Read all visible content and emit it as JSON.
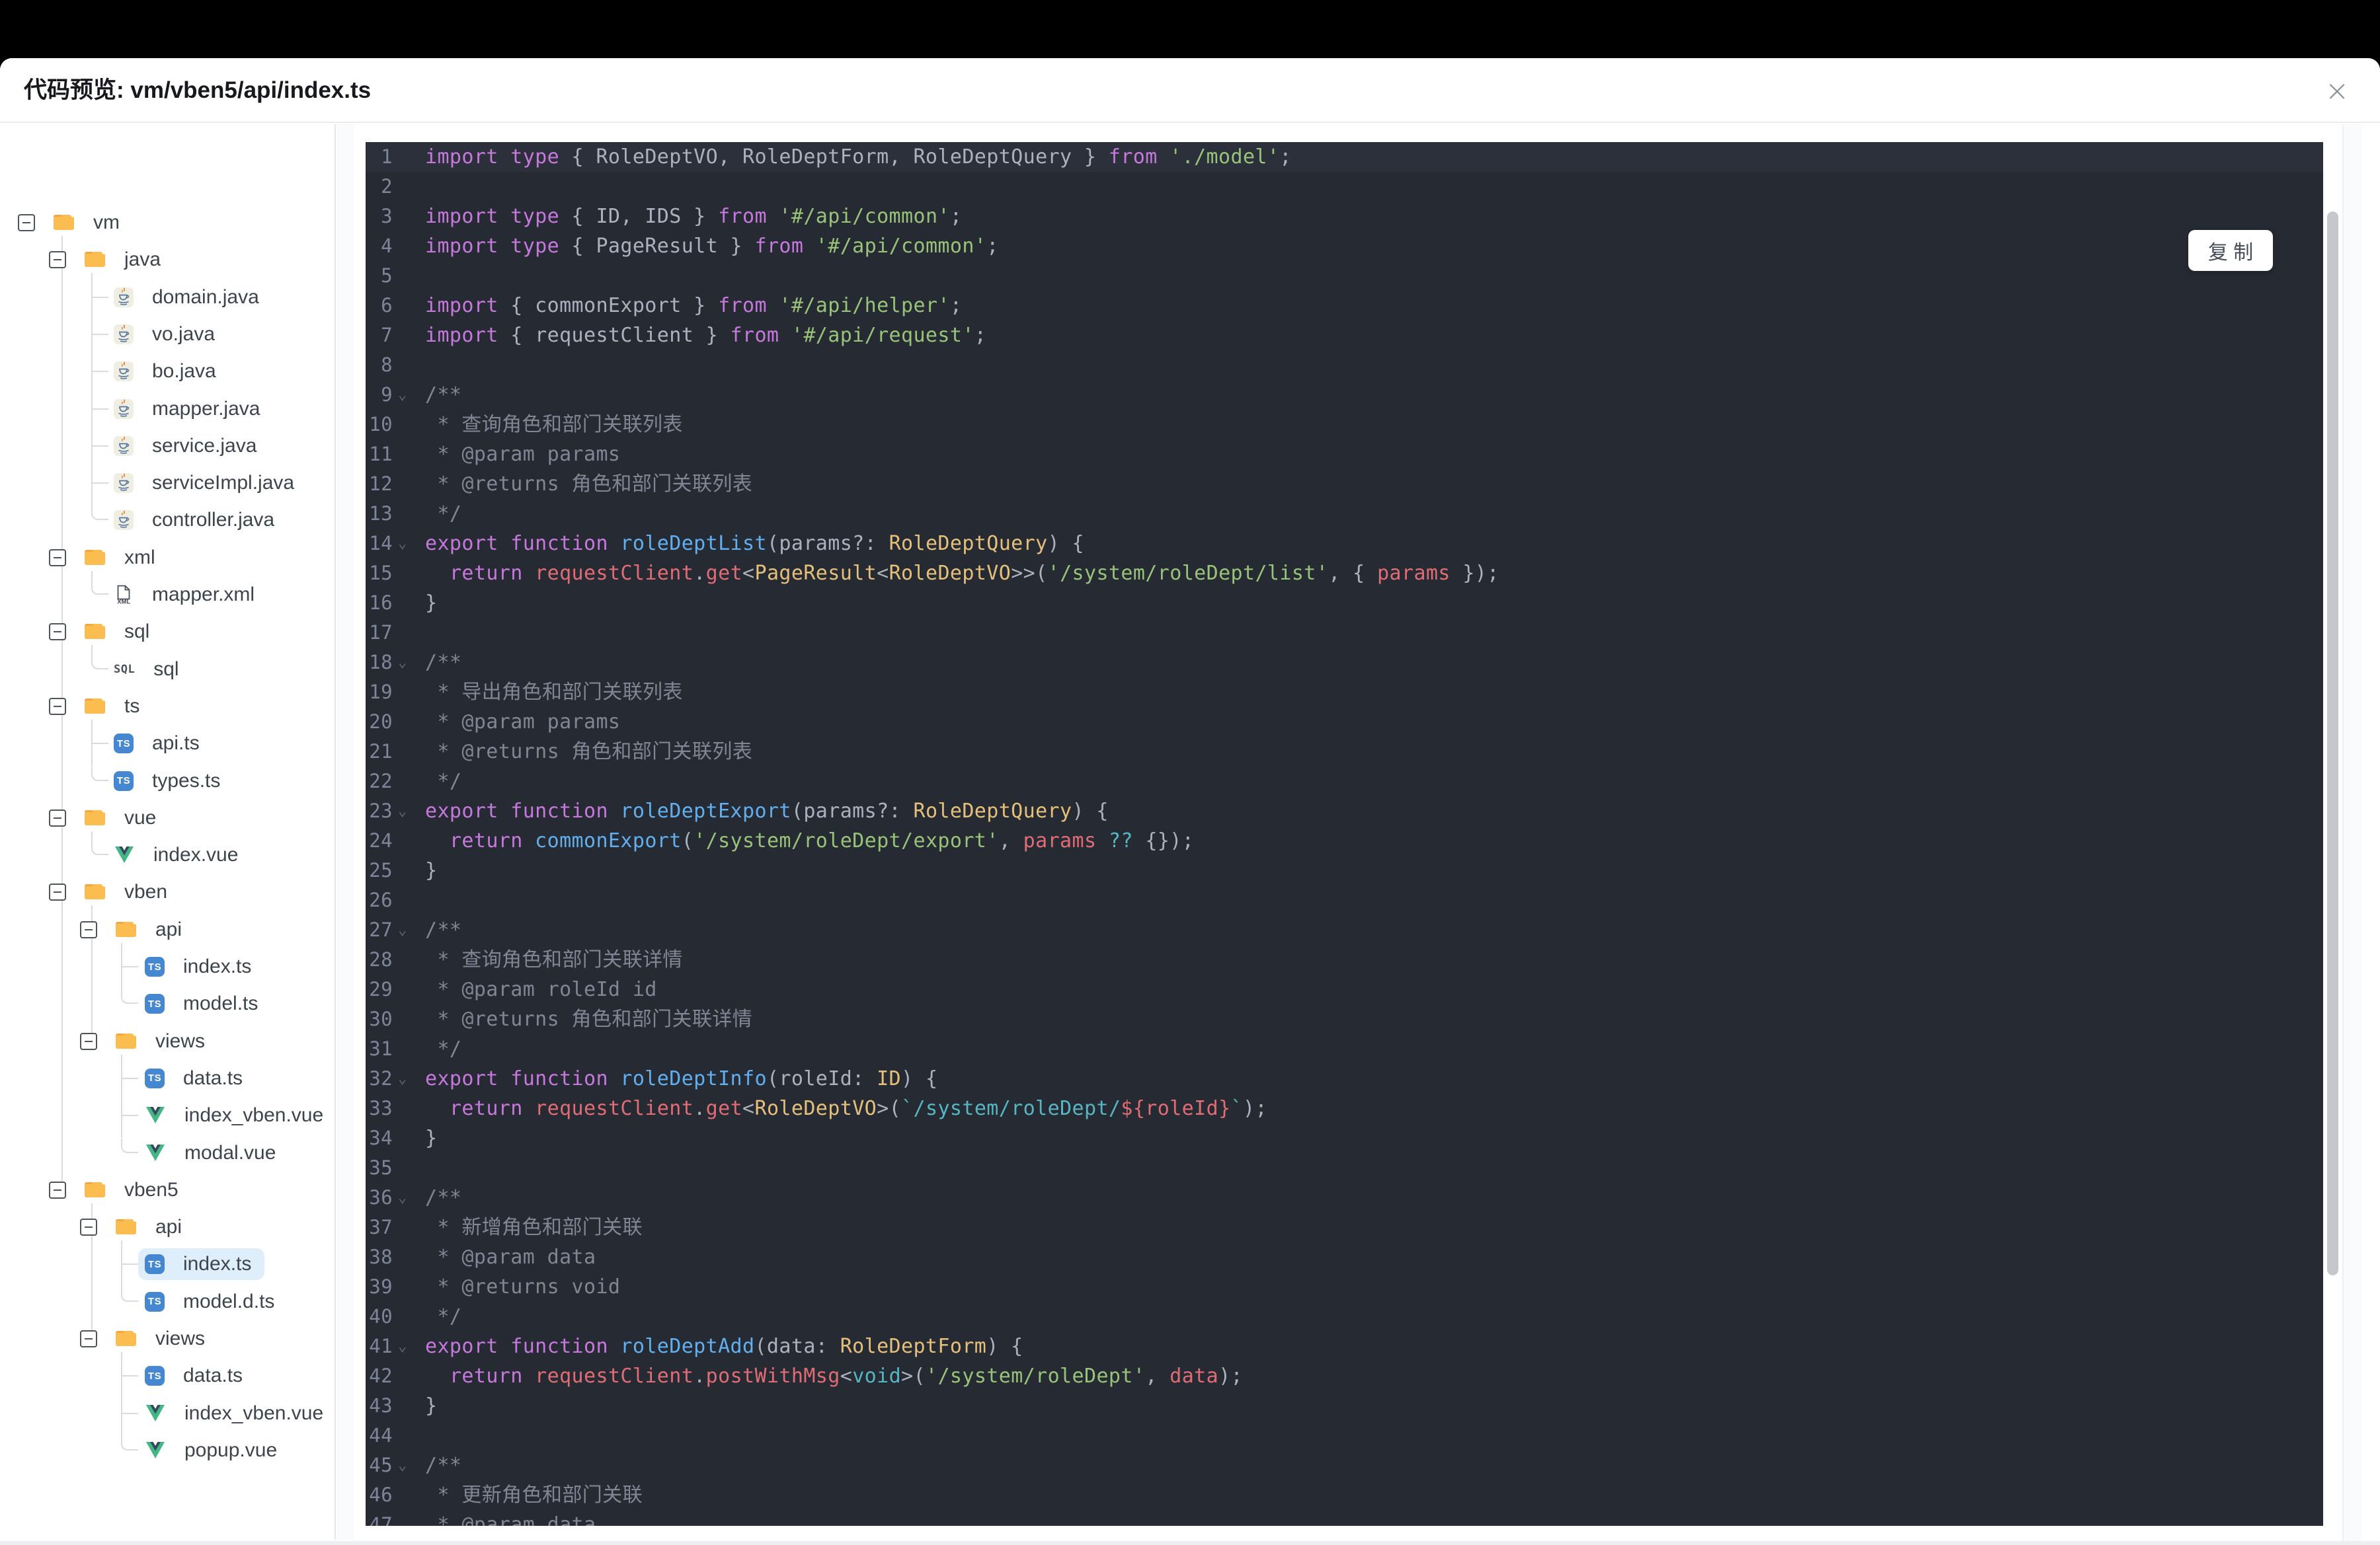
{
  "modal": {
    "title": "代码预览: vm/vben5/api/index.ts",
    "close_icon": "×",
    "copy_label": "复 制"
  },
  "tree": {
    "rows": [
      {
        "type": "folder",
        "level": 0,
        "icon": "folder-icon",
        "label": "vm"
      },
      {
        "type": "folder",
        "level": 1,
        "icon": "folder-icon",
        "label": "java"
      },
      {
        "type": "file",
        "level": 2,
        "icon": "java-file-icon",
        "label": "domain.java"
      },
      {
        "type": "file",
        "level": 2,
        "icon": "java-file-icon",
        "label": "vo.java"
      },
      {
        "type": "file",
        "level": 2,
        "icon": "java-file-icon",
        "label": "bo.java"
      },
      {
        "type": "file",
        "level": 2,
        "icon": "java-file-icon",
        "label": "mapper.java"
      },
      {
        "type": "file",
        "level": 2,
        "icon": "java-file-icon",
        "label": "service.java"
      },
      {
        "type": "file",
        "level": 2,
        "icon": "java-file-icon",
        "label": "serviceImpl.java"
      },
      {
        "type": "file",
        "level": 2,
        "icon": "java-file-icon",
        "label": "controller.java"
      },
      {
        "type": "folder",
        "level": 1,
        "icon": "folder-icon",
        "label": "xml"
      },
      {
        "type": "file",
        "level": 2,
        "icon": "xml-file-icon",
        "label": "mapper.xml"
      },
      {
        "type": "folder",
        "level": 1,
        "icon": "folder-icon",
        "label": "sql"
      },
      {
        "type": "file",
        "level": 2,
        "icon": "sql-file-icon",
        "label": "sql"
      },
      {
        "type": "folder",
        "level": 1,
        "icon": "folder-icon",
        "label": "ts"
      },
      {
        "type": "file",
        "level": 2,
        "icon": "ts-file-icon",
        "label": "api.ts"
      },
      {
        "type": "file",
        "level": 2,
        "icon": "ts-file-icon",
        "label": "types.ts"
      },
      {
        "type": "folder",
        "level": 1,
        "icon": "folder-icon",
        "label": "vue"
      },
      {
        "type": "file",
        "level": 2,
        "icon": "vue-file-icon",
        "label": "index.vue"
      },
      {
        "type": "folder",
        "level": 1,
        "icon": "folder-icon",
        "label": "vben"
      },
      {
        "type": "folder",
        "level": 2,
        "icon": "folder-icon",
        "label": "api"
      },
      {
        "type": "file",
        "level": 3,
        "icon": "ts-file-icon",
        "label": "index.ts"
      },
      {
        "type": "file",
        "level": 3,
        "icon": "ts-file-icon",
        "label": "model.ts"
      },
      {
        "type": "folder",
        "level": 2,
        "icon": "folder-icon",
        "label": "views"
      },
      {
        "type": "file",
        "level": 3,
        "icon": "ts-file-icon",
        "label": "data.ts"
      },
      {
        "type": "file",
        "level": 3,
        "icon": "vue-file-icon",
        "label": "index_vben.vue"
      },
      {
        "type": "file",
        "level": 3,
        "icon": "vue-file-icon",
        "label": "modal.vue"
      },
      {
        "type": "folder",
        "level": 1,
        "icon": "folder-icon",
        "label": "vben5"
      },
      {
        "type": "folder",
        "level": 2,
        "icon": "folder-icon",
        "label": "api"
      },
      {
        "type": "file",
        "level": 3,
        "icon": "ts-file-icon",
        "label": "index.ts",
        "selected": true
      },
      {
        "type": "file",
        "level": 3,
        "icon": "ts-file-icon",
        "label": "model.d.ts"
      },
      {
        "type": "folder",
        "level": 2,
        "icon": "folder-icon",
        "label": "views"
      },
      {
        "type": "file",
        "level": 3,
        "icon": "ts-file-icon",
        "label": "data.ts"
      },
      {
        "type": "file",
        "level": 3,
        "icon": "vue-file-icon",
        "label": "index_vben.vue"
      },
      {
        "type": "file",
        "level": 3,
        "icon": "vue-file-icon",
        "label": "popup.vue"
      }
    ]
  },
  "code": {
    "language": "typescript",
    "palette": {
      "k": "#c678dd",
      "p": "#abb2bf",
      "t": "#e5c07b",
      "s": "#98c379",
      "f": "#61afef",
      "r": "#e06c75",
      "c": "#56b6c2",
      "m": "#7f8794"
    },
    "lines": [
      {
        "hl": true,
        "seg": [
          [
            "k",
            "import type "
          ],
          [
            "p",
            "{ RoleDeptVO, RoleDeptForm, RoleDeptQuery } "
          ],
          [
            "k",
            "from "
          ],
          [
            "s",
            "'./model'"
          ],
          [
            "p",
            ";"
          ]
        ]
      },
      {
        "seg": []
      },
      {
        "seg": [
          [
            "k",
            "import type "
          ],
          [
            "p",
            "{ ID, IDS } "
          ],
          [
            "k",
            "from "
          ],
          [
            "s",
            "'#/api/common'"
          ],
          [
            "p",
            ";"
          ]
        ]
      },
      {
        "seg": [
          [
            "k",
            "import type "
          ],
          [
            "p",
            "{ PageResult } "
          ],
          [
            "k",
            "from "
          ],
          [
            "s",
            "'#/api/common'"
          ],
          [
            "p",
            ";"
          ]
        ]
      },
      {
        "seg": []
      },
      {
        "seg": [
          [
            "k",
            "import "
          ],
          [
            "p",
            "{ commonExport } "
          ],
          [
            "k",
            "from "
          ],
          [
            "s",
            "'#/api/helper'"
          ],
          [
            "p",
            ";"
          ]
        ]
      },
      {
        "seg": [
          [
            "k",
            "import "
          ],
          [
            "p",
            "{ requestClient } "
          ],
          [
            "k",
            "from "
          ],
          [
            "s",
            "'#/api/request'"
          ],
          [
            "p",
            ";"
          ]
        ]
      },
      {
        "seg": []
      },
      {
        "fold": true,
        "seg": [
          [
            "m",
            "/**"
          ]
        ]
      },
      {
        "seg": [
          [
            "m",
            " * 查询角色和部门关联列表"
          ]
        ]
      },
      {
        "seg": [
          [
            "m",
            " * @param params"
          ]
        ]
      },
      {
        "seg": [
          [
            "m",
            " * @returns 角色和部门关联列表"
          ]
        ]
      },
      {
        "seg": [
          [
            "m",
            " */"
          ]
        ]
      },
      {
        "fold": true,
        "seg": [
          [
            "k",
            "export function "
          ],
          [
            "f",
            "roleDeptList"
          ],
          [
            "p",
            "(params?: "
          ],
          [
            "t",
            "RoleDeptQuery"
          ],
          [
            "p",
            ") {"
          ]
        ]
      },
      {
        "seg": [
          [
            "p",
            "  "
          ],
          [
            "k",
            "return "
          ],
          [
            "r",
            "requestClient"
          ],
          [
            "p",
            "."
          ],
          [
            "r",
            "get"
          ],
          [
            "p",
            "<"
          ],
          [
            "t",
            "PageResult"
          ],
          [
            "p",
            "<"
          ],
          [
            "t",
            "RoleDeptVO"
          ],
          [
            "p",
            ">>("
          ],
          [
            "s",
            "'/system/roleDept/list'"
          ],
          [
            "p",
            ", { "
          ],
          [
            "r",
            "params"
          ],
          [
            "p",
            " });"
          ]
        ]
      },
      {
        "seg": [
          [
            "p",
            "}"
          ]
        ]
      },
      {
        "seg": []
      },
      {
        "fold": true,
        "seg": [
          [
            "m",
            "/**"
          ]
        ]
      },
      {
        "seg": [
          [
            "m",
            " * 导出角色和部门关联列表"
          ]
        ]
      },
      {
        "seg": [
          [
            "m",
            " * @param params"
          ]
        ]
      },
      {
        "seg": [
          [
            "m",
            " * @returns 角色和部门关联列表"
          ]
        ]
      },
      {
        "seg": [
          [
            "m",
            " */"
          ]
        ]
      },
      {
        "fold": true,
        "seg": [
          [
            "k",
            "export function "
          ],
          [
            "f",
            "roleDeptExport"
          ],
          [
            "p",
            "(params?: "
          ],
          [
            "t",
            "RoleDeptQuery"
          ],
          [
            "p",
            ") {"
          ]
        ]
      },
      {
        "seg": [
          [
            "p",
            "  "
          ],
          [
            "k",
            "return "
          ],
          [
            "f",
            "commonExport"
          ],
          [
            "p",
            "("
          ],
          [
            "s",
            "'/system/roleDept/export'"
          ],
          [
            "p",
            ", "
          ],
          [
            "r",
            "params"
          ],
          [
            "p",
            " "
          ],
          [
            "c",
            "??"
          ],
          [
            "p",
            " {});"
          ]
        ]
      },
      {
        "seg": [
          [
            "p",
            "}"
          ]
        ]
      },
      {
        "seg": []
      },
      {
        "fold": true,
        "seg": [
          [
            "m",
            "/**"
          ]
        ]
      },
      {
        "seg": [
          [
            "m",
            " * 查询角色和部门关联详情"
          ]
        ]
      },
      {
        "seg": [
          [
            "m",
            " * @param roleId id"
          ]
        ]
      },
      {
        "seg": [
          [
            "m",
            " * @returns 角色和部门关联详情"
          ]
        ]
      },
      {
        "seg": [
          [
            "m",
            " */"
          ]
        ]
      },
      {
        "fold": true,
        "seg": [
          [
            "k",
            "export function "
          ],
          [
            "f",
            "roleDeptInfo"
          ],
          [
            "p",
            "(roleId: "
          ],
          [
            "t",
            "ID"
          ],
          [
            "p",
            ") {"
          ]
        ]
      },
      {
        "seg": [
          [
            "p",
            "  "
          ],
          [
            "k",
            "return "
          ],
          [
            "r",
            "requestClient"
          ],
          [
            "p",
            "."
          ],
          [
            "r",
            "get"
          ],
          [
            "p",
            "<"
          ],
          [
            "t",
            "RoleDeptVO"
          ],
          [
            "p",
            ">("
          ],
          [
            "c",
            "`/system/roleDept/"
          ],
          [
            "r",
            "${roleId}"
          ],
          [
            "c",
            "`"
          ],
          [
            "p",
            ");"
          ]
        ]
      },
      {
        "seg": [
          [
            "p",
            "}"
          ]
        ]
      },
      {
        "seg": []
      },
      {
        "fold": true,
        "seg": [
          [
            "m",
            "/**"
          ]
        ]
      },
      {
        "seg": [
          [
            "m",
            " * 新增角色和部门关联"
          ]
        ]
      },
      {
        "seg": [
          [
            "m",
            " * @param data"
          ]
        ]
      },
      {
        "seg": [
          [
            "m",
            " * @returns void"
          ]
        ]
      },
      {
        "seg": [
          [
            "m",
            " */"
          ]
        ]
      },
      {
        "fold": true,
        "seg": [
          [
            "k",
            "export function "
          ],
          [
            "f",
            "roleDeptAdd"
          ],
          [
            "p",
            "(data: "
          ],
          [
            "t",
            "RoleDeptForm"
          ],
          [
            "p",
            ") {"
          ]
        ]
      },
      {
        "seg": [
          [
            "p",
            "  "
          ],
          [
            "k",
            "return "
          ],
          [
            "r",
            "requestClient"
          ],
          [
            "p",
            "."
          ],
          [
            "r",
            "postWithMsg"
          ],
          [
            "p",
            "<"
          ],
          [
            "c",
            "void"
          ],
          [
            "p",
            ">("
          ],
          [
            "s",
            "'/system/roleDept'"
          ],
          [
            "p",
            ", "
          ],
          [
            "r",
            "data"
          ],
          [
            "p",
            ");"
          ]
        ]
      },
      {
        "seg": [
          [
            "p",
            "}"
          ]
        ]
      },
      {
        "seg": []
      },
      {
        "fold": true,
        "seg": [
          [
            "m",
            "/**"
          ]
        ]
      },
      {
        "seg": [
          [
            "m",
            " * 更新角色和部门关联"
          ]
        ]
      },
      {
        "seg": [
          [
            "m",
            " * @param data"
          ]
        ]
      }
    ]
  },
  "colors": {
    "backdrop": "#000000",
    "modal_bg": "#ffffff",
    "code_bg": "#262a33",
    "code_line_highlight": "#2c303a",
    "line_number": "#7d8698",
    "selected_row_bg": "#dfeefb",
    "folder_icon": "#fbbd4f",
    "ts_badge": "#4587d1",
    "vue_green": "#41b883",
    "vue_dark": "#35495e",
    "tree_guide": "#d8dbe0",
    "divider": "#e7e9ed",
    "scroll_thumb": "#c5c7cc"
  }
}
